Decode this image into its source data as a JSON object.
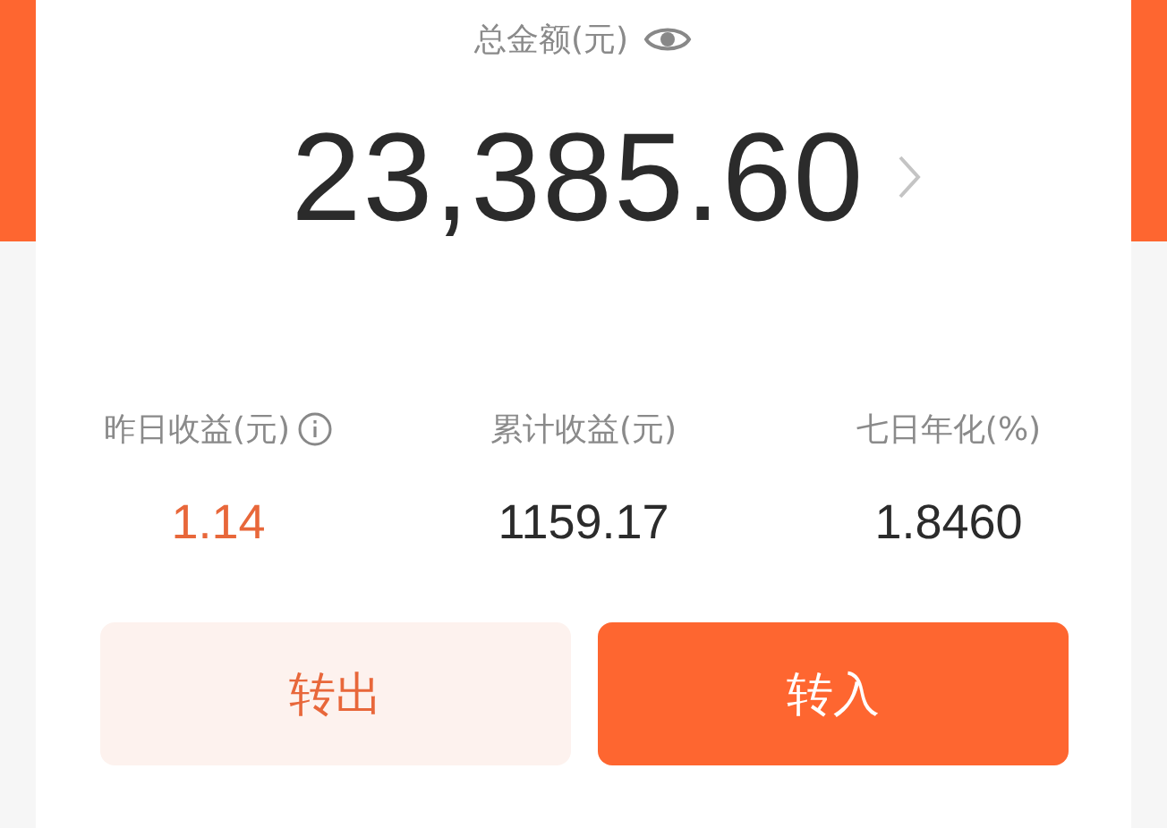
{
  "balance": {
    "label": "总金额(元)",
    "amount": "23,385.60"
  },
  "stats": [
    {
      "label": "昨日收益(元)",
      "kind": "with-info",
      "value": "1.14",
      "color": "#e8673a"
    },
    {
      "label": "累计收益(元)",
      "kind": "plain",
      "value": "1159.17",
      "color": "#2b2b2b"
    },
    {
      "label": "七日年化(%)",
      "kind": "plain",
      "value": "1.8460",
      "color": "#2b2b2b"
    }
  ],
  "buttons": [
    {
      "label": "转出",
      "kind": "secondary"
    },
    {
      "label": "转入",
      "kind": "primary"
    }
  ]
}
